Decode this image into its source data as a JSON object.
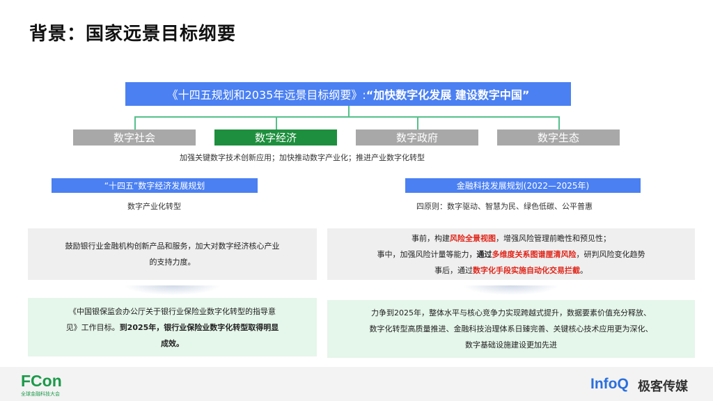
{
  "page_title": "背景：国家远景目标纲要",
  "banner": {
    "prefix": "《十四五规划和2035年远景目标纲要》:",
    "emphasis": "“加快数字化发展 建设数字中国”"
  },
  "categories": [
    {
      "label": "数字社会",
      "active": false
    },
    {
      "label": "数字经济",
      "active": true
    },
    {
      "label": "数字政府",
      "active": false
    },
    {
      "label": "数字生态",
      "active": false
    }
  ],
  "category_note": "加强关键数字技术创新应用；加快推动数字产业化；推进产业数字化转型",
  "left": {
    "header": "“十四五”数字经济发展规划",
    "subtitle": "数字产业化转型",
    "box1": {
      "line1": "鼓励银行业金融机构创新产品和服务，加大对数字经济核心产业",
      "line2": "的支持力度。"
    },
    "box2": {
      "line1": "《中国银保监会办公厅关于银行业保险业数字化转型的指导意",
      "line2_plain": "见》工作目标。",
      "line2_bold": "到2025年，银行业保险业数字化转型取得明显",
      "line3_bold": "成效。"
    }
  },
  "right": {
    "header": "金融科技发展规划(2022—2025年)",
    "subtitle": "四原则：数字驱动、智慧为民、绿色低碳、公平普惠",
    "box1": {
      "l1_a": "事前，构建",
      "l1_red": "风险全景视图",
      "l1_b": "，增强风险管理前瞻性和预见性；",
      "l2_a": "事中，加强风险计量等能力，",
      "l2_bold": "通过",
      "l2_red": "多维度关系图谱厘清风险",
      "l2_b": "，研判风险变化趋势",
      "l3_a": "事后，通过",
      "l3_red": "数字化手段实施自动化交易拦截",
      "l3_b": "。"
    },
    "box2": {
      "line1": "力争到2025年，整体水平与核心竞争力实现跨越式提升，数据要素价值充分释放、",
      "line2": "数字化转型高质量推进、金融科技治理体系日臻完善、关键核心技术应用更为深化、",
      "line3": "数字基础设施建设更加先进"
    }
  },
  "footer": {
    "fcon_logo": "FCon",
    "fcon_sub": "全球金融科技大会",
    "infoq_logo": "InfoQ",
    "geek_logo": "极客传媒"
  },
  "colors": {
    "accent_blue": "#4b80f2",
    "active_green": "#1e8f3e",
    "inactive_grey": "#a8a8a8",
    "highlight_red": "#e0261a",
    "connector_green": "#55c08a"
  }
}
